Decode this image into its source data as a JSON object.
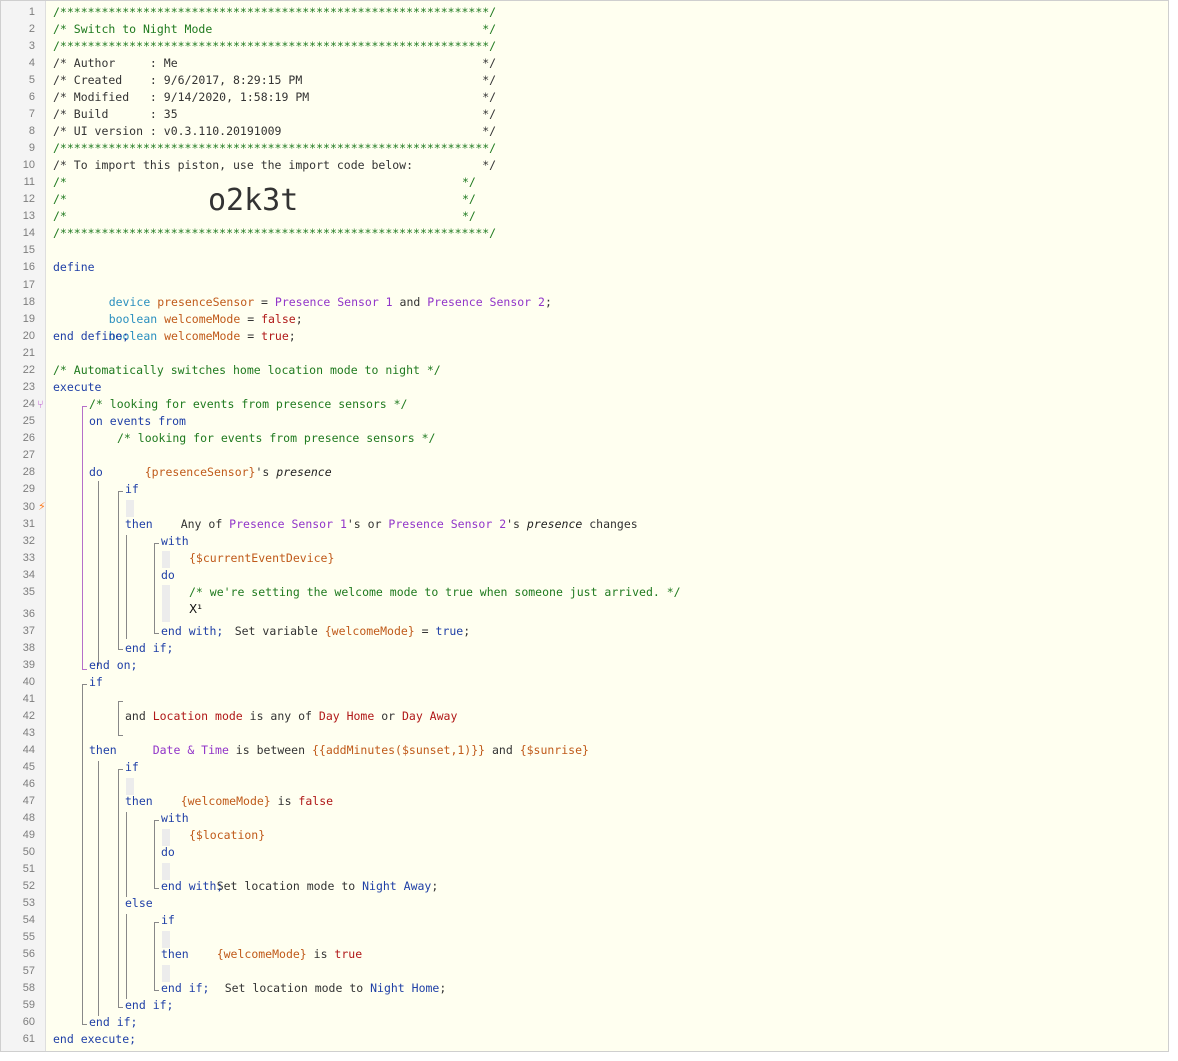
{
  "editor": {
    "line_numbers": [
      "1",
      "2",
      "3",
      "4",
      "5",
      "6",
      "7",
      "8",
      "9",
      "10",
      "11",
      "12",
      "13",
      "14",
      "15",
      "16",
      "17",
      "18",
      "19",
      "20",
      "21",
      "22",
      "23",
      "24",
      "25",
      "26",
      "27",
      "28",
      "29",
      "30",
      "31",
      "32",
      "33",
      "34",
      "35",
      "36",
      "37",
      "38",
      "39",
      "40",
      "41",
      "42",
      "43",
      "44",
      "45",
      "46",
      "47",
      "48",
      "49",
      "50",
      "51",
      "52",
      "53",
      "54",
      "55",
      "56",
      "57",
      "58",
      "59",
      "60",
      "61"
    ],
    "gutter_icons": {
      "line24": "branch-icon",
      "line30": "lightning-icon",
      "line36": "variable-x-icon"
    },
    "colors": {
      "comment": "#1f7a1f",
      "keyword": "#1f3fa6",
      "type": "#2a8fbf",
      "variable": "#c05a1a",
      "device": "#9135c9",
      "value": "#b01818",
      "background": "#fffff0"
    }
  },
  "header": {
    "l1": "/**************************************************************/",
    "l2": "/* Switch to Night Mode                                       */",
    "l3": "/**************************************************************/",
    "l4": "/* Author     : Me                                            */",
    "l5": "/* Created    : 9/6/2017, 8:29:15 PM                          */",
    "l6": "/* Modified   : 9/14/2020, 1:58:19 PM                         */",
    "l7": "/* Build      : 35                                            */",
    "l8": "/* UI version : v0.3.110.20191009                             */",
    "l9": "/**************************************************************/",
    "l10": "/* To import this piston, use the import code below:          */",
    "l11a": "/*",
    "l11b": "*/",
    "l12a": "/*",
    "l12b": "*/",
    "l13a": "/*",
    "l13b": "*/",
    "l14": "/**************************************************************/",
    "import_code": "o2k3t"
  },
  "define": {
    "kw_define": "define",
    "l17_type": "device",
    "l17_var": "presenceSensor",
    "l17_eq": " = ",
    "l17_dev1": "Presence Sensor 1",
    "l17_and": " and ",
    "l17_dev2": "Presence Sensor 2",
    "l17_semi": ";",
    "l18_type": "boolean",
    "l18_var": "welcomeMode",
    "l18_eq": " = ",
    "l18_val": "false",
    "l18_semi": ";",
    "l19_type": "boolean",
    "l19_var": "welcomeMode",
    "l19_eq": " = ",
    "l19_val": "true",
    "l19_semi": ";",
    "kw_end": "end define;"
  },
  "execute": {
    "l22": "/* Automatically switches home location mode to night */",
    "kw_execute": "execute",
    "l24": "/* looking for events from presence sensors */",
    "l25": "on events from",
    "l26": "/* looking for events from presence sensors */",
    "l27_var": "{presenceSensor}",
    "l27_rest": "'s ",
    "l27_attr": "presence",
    "l28": "do",
    "l29": "if",
    "l30_a": "Any of ",
    "l30_d1": "Presence Sensor 1",
    "l30_b": "'s or ",
    "l30_d2": "Presence Sensor 2",
    "l30_c": "'s ",
    "l30_attr": "presence",
    "l30_d": " changes",
    "l31": "then",
    "l32": "with",
    "l33": "{$currentEventDevice}",
    "l34": "do",
    "l35": "/* we're setting the welcome mode to true when someone just arrived. */",
    "l36_icon": "X¹",
    "l36_a": "Set variable ",
    "l36_var": "{welcomeMode}",
    "l36_b": " = ",
    "l36_val": "true",
    "l36_c": ";",
    "l37": "end with;",
    "l38": "end if;",
    "l39": "end on;",
    "l40": "if",
    "l41_a": "Location mode",
    "l41_b": " is any of ",
    "l41_v1": "Day Home",
    "l41_c": " or ",
    "l41_v2": "Day Away",
    "l42": "and",
    "l43_a": "Date & Time",
    "l43_b": " is between ",
    "l43_v1": "{{addMinutes($sunset,1)}}",
    "l43_c": " and ",
    "l43_v2": "{$sunrise}",
    "l44": "then",
    "l45": "if",
    "l46_var": "{welcomeMode}",
    "l46_b": " is ",
    "l46_val": "false",
    "l47": "then",
    "l48": "with",
    "l49": "{$location}",
    "l50": "do",
    "l51_a": "Set location mode to ",
    "l51_v": "Night Away",
    "l51_c": ";",
    "l52": "end with;",
    "l53": "else",
    "l54": "if",
    "l55_var": "{welcomeMode}",
    "l55_b": " is ",
    "l55_val": "true",
    "l56": "then",
    "l57_a": "Set location mode to ",
    "l57_v": "Night Home",
    "l57_c": ";",
    "l58": "end if;",
    "l59": "end if;",
    "l60": "end if;",
    "l61": "end execute;"
  }
}
